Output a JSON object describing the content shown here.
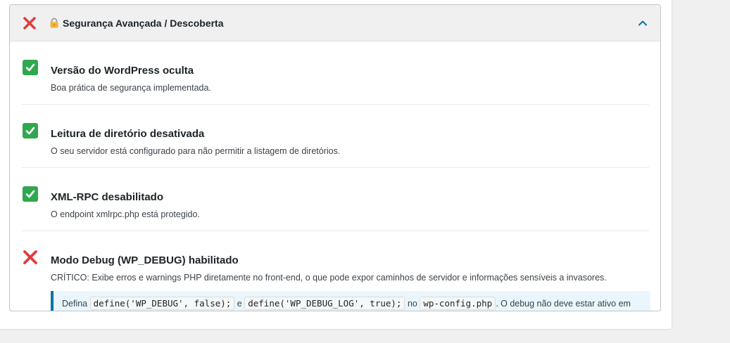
{
  "section": {
    "status_icon": "cross-mark-icon",
    "lock_icon": "lock-icon",
    "title": "Segurança Avançada / Descoberta",
    "toggle_icon": "chevron-up-icon",
    "expanded": true
  },
  "items": [
    {
      "status": "pass",
      "icon": "check-mark-icon",
      "title": "Versão do WordPress oculta",
      "description": "Boa prática de segurança implementada."
    },
    {
      "status": "pass",
      "icon": "check-mark-icon",
      "title": "Leitura de diretório desativada",
      "description": "O seu servidor está configurado para não permitir a listagem de diretórios."
    },
    {
      "status": "pass",
      "icon": "check-mark-icon",
      "title": "XML-RPC desabilitado",
      "description": "O endpoint xmlrpc.php está protegido."
    },
    {
      "status": "fail",
      "icon": "cross-mark-icon",
      "title": "Modo Debug (WP_DEBUG) habilitado",
      "description": "CRÍTICO: Exibe erros e warnings PHP diretamente no front-end, o que pode expor caminhos de servidor e informações sensíveis a invasores.",
      "recommendation": {
        "prefix": "Defina",
        "code1": "define('WP_DEBUG', false);",
        "joiner1": "e",
        "code2": "define('WP_DEBUG_LOG', true);",
        "joiner2": "no",
        "code3": "wp-config.php",
        "suffix": ". O debug não deve estar ativo em produção."
      }
    }
  ],
  "colors": {
    "pass": "#2fa84f",
    "fail": "#e03e3e",
    "accent": "#0a73aa",
    "note_bg": "#eaf6fc"
  }
}
